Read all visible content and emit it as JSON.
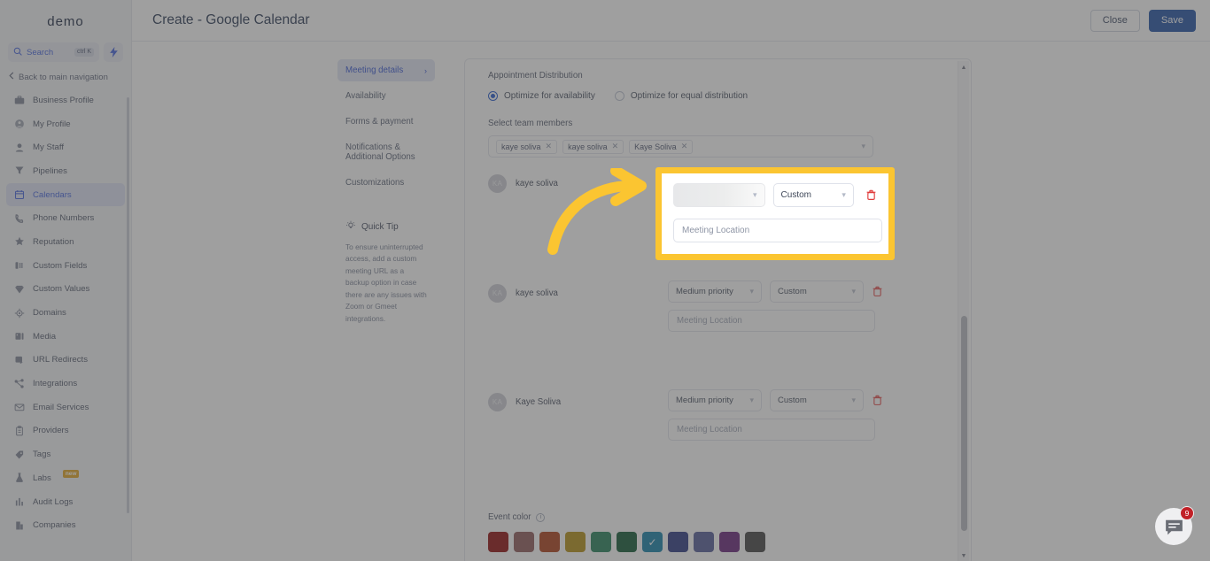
{
  "sidebar": {
    "brand": "demo",
    "search": {
      "placeholder": "Search",
      "shortcut": "ctrl K",
      "icon": "search-icon"
    },
    "bolt_icon": "bolt-icon",
    "back_label": "Back to main navigation",
    "items": [
      {
        "label": "Business Profile",
        "icon": "briefcase-icon",
        "active": false
      },
      {
        "label": "My Profile",
        "icon": "user-circle-icon",
        "active": false
      },
      {
        "label": "My Staff",
        "icon": "user-icon",
        "active": false
      },
      {
        "label": "Pipelines",
        "icon": "funnel-icon",
        "active": false
      },
      {
        "label": "Calendars",
        "icon": "calendar-icon",
        "active": true
      },
      {
        "label": "Phone Numbers",
        "icon": "phone-icon",
        "active": false
      },
      {
        "label": "Reputation",
        "icon": "star-icon",
        "active": false
      },
      {
        "label": "Custom Fields",
        "icon": "fields-icon",
        "active": false
      },
      {
        "label": "Custom Values",
        "icon": "diamond-icon",
        "active": false
      },
      {
        "label": "Domains",
        "icon": "globe-icon",
        "active": false
      },
      {
        "label": "Media",
        "icon": "media-icon",
        "active": false
      },
      {
        "label": "URL Redirects",
        "icon": "redirect-icon",
        "active": false
      },
      {
        "label": "Integrations",
        "icon": "integrations-icon",
        "active": false
      },
      {
        "label": "Email Services",
        "icon": "mail-icon",
        "active": false
      },
      {
        "label": "Providers",
        "icon": "clipboard-icon",
        "active": false
      },
      {
        "label": "Tags",
        "icon": "tag-icon",
        "active": false
      },
      {
        "label": "Labs",
        "icon": "flask-icon",
        "active": false,
        "badge": "new"
      },
      {
        "label": "Audit Logs",
        "icon": "bars-icon",
        "active": false
      },
      {
        "label": "Companies",
        "icon": "building-icon",
        "active": false
      }
    ]
  },
  "topbar": {
    "title": "Create - Google Calendar",
    "close_label": "Close",
    "save_label": "Save"
  },
  "modal_nav": {
    "items": [
      {
        "label": "Meeting details",
        "active": true,
        "chevron": "chevron-right-icon"
      },
      {
        "label": "Availability",
        "active": false
      },
      {
        "label": "Forms & payment",
        "active": false
      },
      {
        "label": "Notifications & Additional Options",
        "active": false
      },
      {
        "label": "Customizations",
        "active": false
      }
    ],
    "quick_tip": {
      "icon": "lightbulb-icon",
      "title": "Quick Tip",
      "body": "To ensure uninterrupted access, add a custom meeting URL as a backup option in case there are any issues with Zoom or Gmeet integrations."
    }
  },
  "main": {
    "distribution": {
      "label": "Appointment Distribution",
      "options": [
        {
          "label": "Optimize for availability",
          "selected": true
        },
        {
          "label": "Optimize for equal distribution",
          "selected": false
        }
      ]
    },
    "team": {
      "label": "Select team members",
      "chips": [
        "kaye soliva",
        "kaye soliva",
        "Kaye Soliva"
      ],
      "remove_icon": "close-icon",
      "caret_icon": "chevron-down-icon"
    },
    "members": [
      {
        "avatar_initials": "KA",
        "name": "kaye soliva",
        "priority": "",
        "priority_loading": true,
        "meeting_type": "Custom",
        "location_placeholder": "Meeting Location",
        "delete_icon": "trash-icon"
      },
      {
        "avatar_initials": "KA",
        "name": "kaye soliva",
        "priority": "Medium priority",
        "priority_loading": false,
        "meeting_type": "Custom",
        "location_placeholder": "Meeting Location",
        "delete_icon": "trash-icon"
      },
      {
        "avatar_initials": "KA",
        "name": "Kaye Soliva",
        "priority": "Medium priority",
        "priority_loading": false,
        "meeting_type": "Custom",
        "location_placeholder": "Meeting Location",
        "delete_icon": "trash-icon"
      }
    ],
    "event_color": {
      "label": "Event color",
      "info_icon": "info-icon",
      "selected_index": 6,
      "check_icon": "check-icon",
      "swatches": [
        "#8a0000",
        "#8a5352",
        "#a8360f",
        "#b08a09",
        "#1c7a52",
        "#05502c",
        "#0b7ba5",
        "#23307c",
        "#4d5592",
        "#611a74",
        "#3b3b3b"
      ]
    }
  },
  "annotation": {
    "highlight_border_color": "#fbc531",
    "arrow_icon": "curved-arrow-icon",
    "highlight": {
      "priority_value": "",
      "priority_loading": true,
      "meeting_type": "Custom",
      "location_placeholder": "Meeting Location",
      "delete_icon": "trash-icon",
      "caret_icon": "chevron-down-icon"
    }
  },
  "chat": {
    "icon": "chat-bubble-icon",
    "badge": "9"
  },
  "scrollbar": {
    "up_icon": "caret-up-icon",
    "down_icon": "caret-down-icon"
  }
}
